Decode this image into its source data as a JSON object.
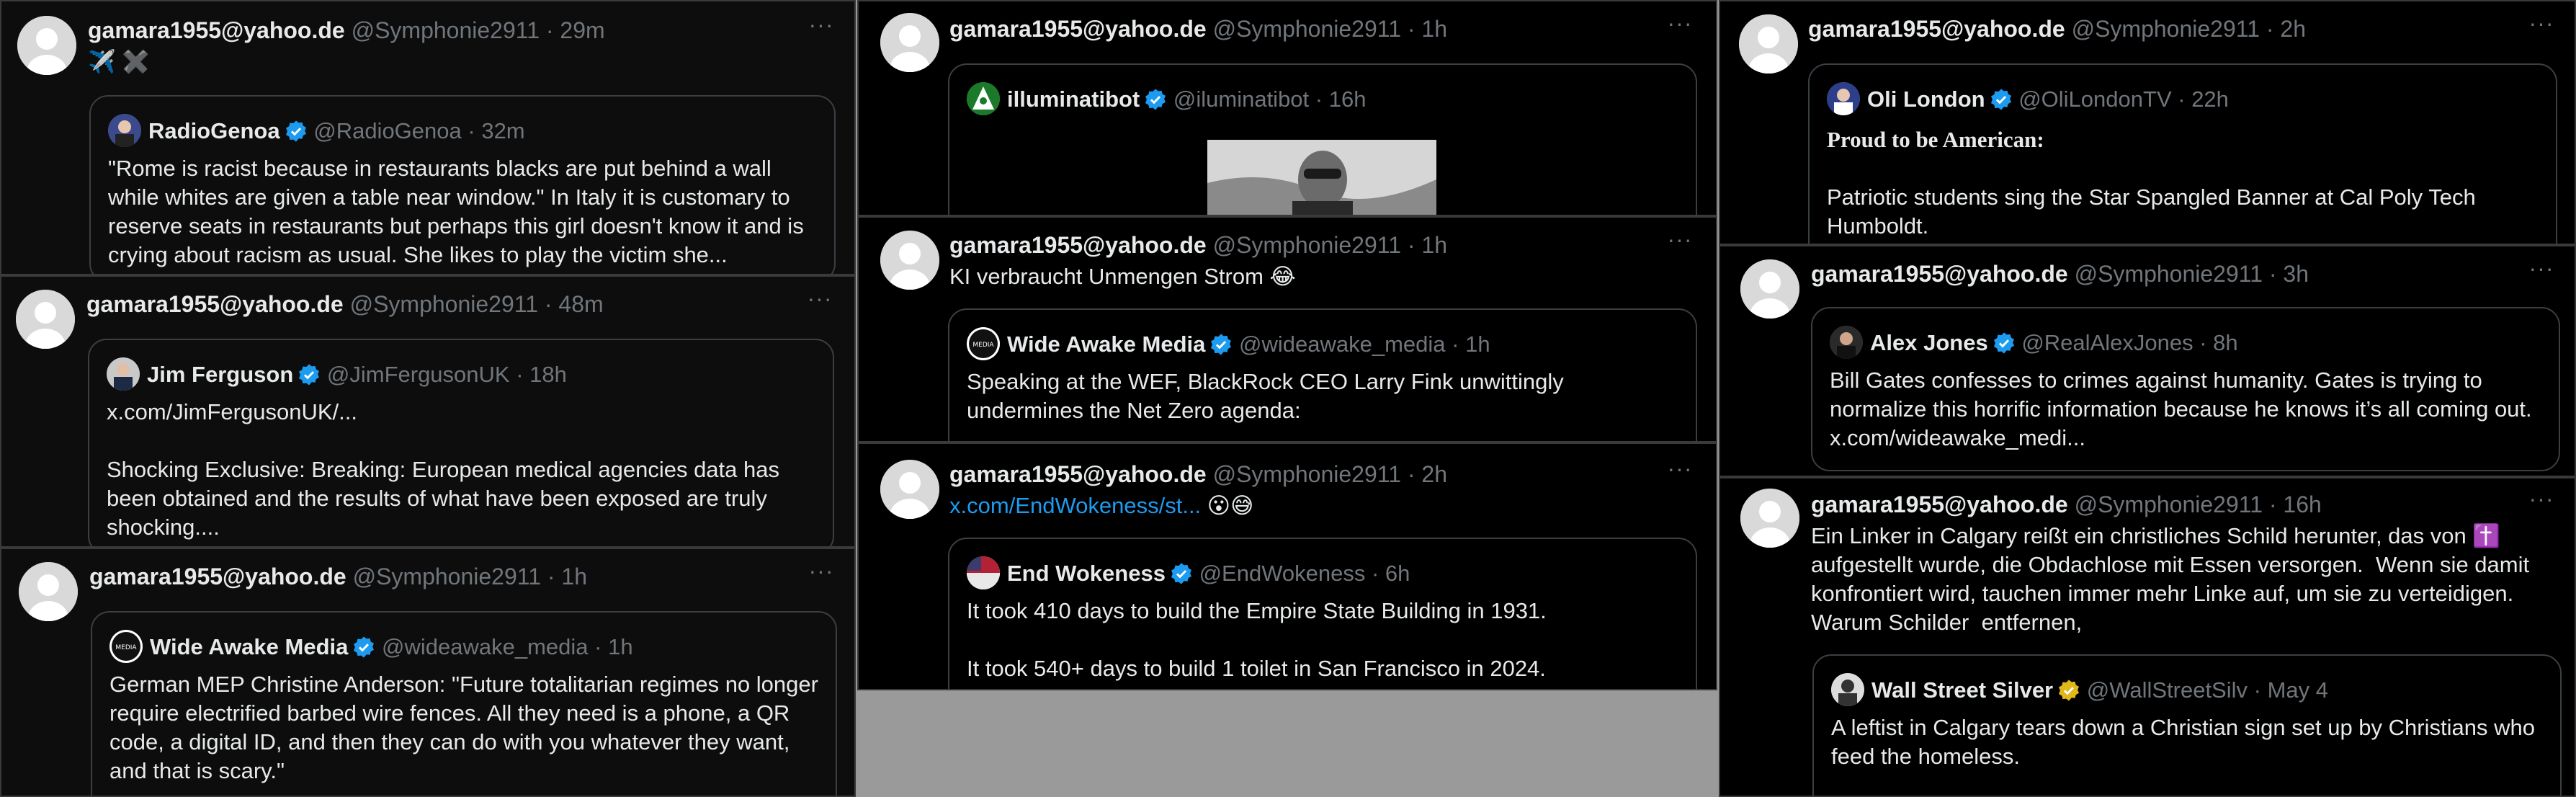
{
  "colors": {
    "bg": "#000000",
    "name": "#e7e9ea",
    "muted": "#71767b",
    "link": "#1d9bf0",
    "verified_blue": "#1d9bf0",
    "verified_gold": "#e2b719"
  },
  "icons": {
    "more": "more-icon",
    "verified": "verified-badge-icon",
    "avatar_default": "default-avatar-icon"
  },
  "tweets": [
    {
      "name": "gamara1955@yahoo.de",
      "handle": "@Symphonie2911",
      "time": "29m",
      "text": "✈️ ✖️",
      "quote": {
        "name": "RadioGenoa",
        "handle": "@RadioGenoa",
        "time": "32m",
        "text": "\"Rome is racist because in restaurants blacks are put behind a wall while whites are given a table near window.\" In Italy it is customary to reserve seats in restaurants but perhaps this girl doesn't know it and is crying about racism as usual. She likes to play the victim she..."
      }
    },
    {
      "name": "gamara1955@yahoo.de",
      "handle": "@Symphonie2911",
      "time": "48m",
      "quote": {
        "name": "Jim Ferguson",
        "handle": "@JimFergusonUK",
        "time": "18h",
        "text": "x.com/JimFergusonUK/...\n\nShocking Exclusive: Breaking: European medical agencies data has been obtained and the results of what have been exposed are truly shocking...."
      }
    },
    {
      "name": "gamara1955@yahoo.de",
      "handle": "@Symphonie2911",
      "time": "1h",
      "quote": {
        "name": "Wide Awake Media",
        "handle": "@wideawake_media",
        "time": "1h",
        "text": "German MEP Christine Anderson: \"Future totalitarian regimes no longer require electrified barbed wire fences. All they need is a phone, a QR code, a digital ID, and then they can do with you whatever they want, and that is scary.\""
      }
    },
    {
      "name": "gamara1955@yahoo.de",
      "handle": "@Symphonie2911",
      "time": "1h",
      "quote": {
        "name": "illuminatibot",
        "handle": "@iluminatibot",
        "time": "16h"
      }
    },
    {
      "name": "gamara1955@yahoo.de",
      "handle": "@Symphonie2911",
      "time": "1h",
      "text": "KI verbraucht Unmengen Strom 😂",
      "quote": {
        "name": "Wide Awake Media",
        "handle": "@wideawake_media",
        "time": "1h",
        "text": "Speaking at the WEF, BlackRock CEO Larry Fink unwittingly undermines the Net Zero agenda:"
      }
    },
    {
      "name": "gamara1955@yahoo.de",
      "handle": "@Symphonie2911",
      "time": "2h",
      "link": "x.com/EndWokeness/st...",
      "text": " 😮😅",
      "quote": {
        "name": "End Wokeness",
        "handle": "@EndWokeness",
        "time": "6h",
        "text": "It took 410 days to build the Empire State Building in 1931.\n\nIt took 540+ days to build 1 toilet in San Francisco in 2024."
      }
    },
    {
      "name": "gamara1955@yahoo.de",
      "handle": "@Symphonie2911",
      "time": "2h",
      "quote": {
        "name": "Oli London",
        "handle": "@OliLondonTV",
        "time": "22h",
        "title": "Proud to be American:",
        "text": "Patriotic students sing the Star Spangled Banner at Cal Poly Tech Humboldt."
      }
    },
    {
      "name": "gamara1955@yahoo.de",
      "handle": "@Symphonie2911",
      "time": "3h",
      "quote": {
        "name": "Alex Jones",
        "handle": "@RealAlexJones",
        "time": "8h",
        "text": "Bill Gates confesses to crimes against humanity. Gates is trying to normalize this horrific information because he knows it’s all coming out. x.com/wideawake_medi..."
      }
    },
    {
      "name": "gamara1955@yahoo.de",
      "handle": "@Symphonie2911",
      "time": "16h",
      "text": "Ein Linker in Calgary reißt ein christliches Schild herunter, das von ✝️ aufgestellt wurde, die Obdachlose mit Essen versorgen.  Wenn sie damit konfrontiert wird, tauchen immer mehr Linke auf, um sie zu verteidigen. Warum Schilder  entfernen,",
      "quote": {
        "name": "Wall Street Silver",
        "handle": "@WallStreetSilv",
        "time": "May 4",
        "text": "A leftist in Calgary tears down a Christian sign set up by Christians who feed the homeless."
      }
    }
  ]
}
